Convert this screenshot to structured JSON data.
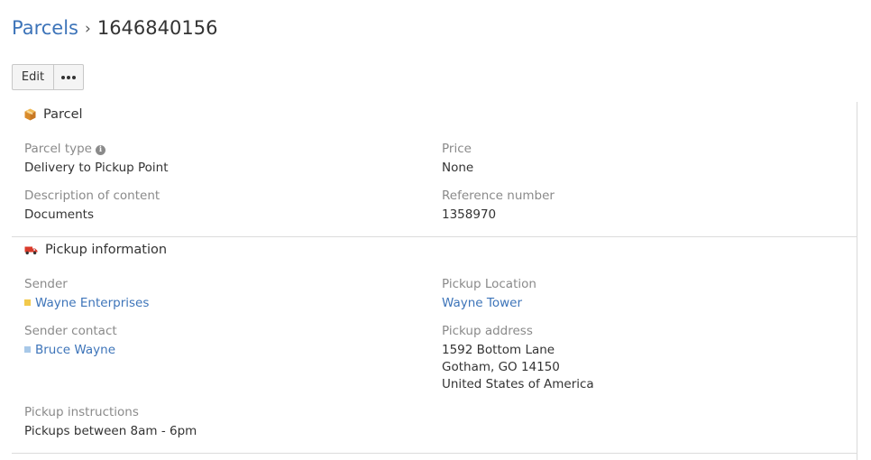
{
  "breadcrumb": {
    "parent": "Parcels",
    "separator": "›",
    "current": "1646840156"
  },
  "toolbar": {
    "edit_label": "Edit",
    "more_icon": "ellipsis-icon"
  },
  "parcel_section": {
    "title": "Parcel",
    "icon": "package-icon",
    "parcel_type": {
      "label": "Parcel type",
      "info_icon": "info-icon",
      "value": "Delivery to Pickup Point"
    },
    "price": {
      "label": "Price",
      "value": "None"
    },
    "description": {
      "label": "Description of content",
      "value": "Documents"
    },
    "reference": {
      "label": "Reference number",
      "value": "1358970"
    }
  },
  "pickup_section": {
    "title": "Pickup information",
    "icon": "truck-icon",
    "sender": {
      "label": "Sender",
      "value": "Wayne Enterprises",
      "swatch_color": "#f2c94c"
    },
    "pickup_location": {
      "label": "Pickup Location",
      "value": "Wayne Tower"
    },
    "sender_contact": {
      "label": "Sender contact",
      "value": "Bruce Wayne",
      "swatch_color": "#a8c8e8"
    },
    "pickup_address": {
      "label": "Pickup address",
      "lines": [
        "1592 Bottom Lane",
        "Gotham, GO 14150",
        "United States of America"
      ]
    },
    "pickup_instructions": {
      "label": "Pickup instructions",
      "value": "Pickups between 8am - 6pm"
    }
  },
  "colors": {
    "link": "#3d74b9",
    "label": "#8a8a8a",
    "text": "#333333"
  }
}
